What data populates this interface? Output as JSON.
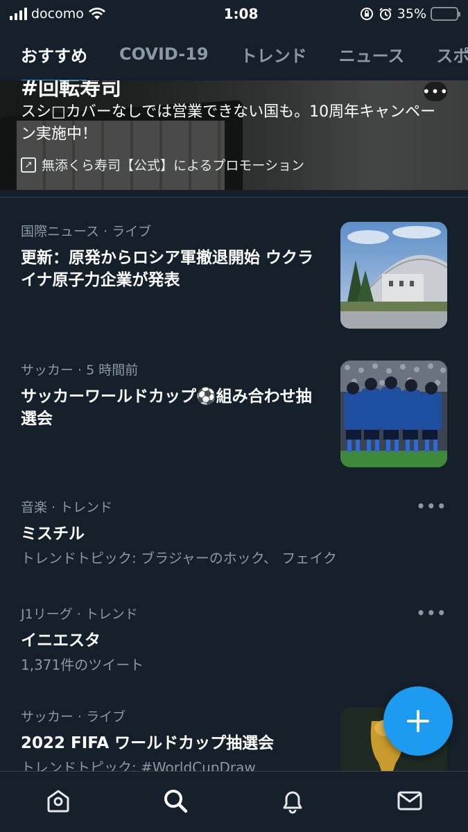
{
  "status_bar": {
    "carrier": "docomo",
    "time": "1:08",
    "battery": "35%",
    "battery_level": 0.35
  },
  "tabs": [
    {
      "label": "おすすめ",
      "active": true
    },
    {
      "label": "COVID-19",
      "active": false
    },
    {
      "label": "トレンド",
      "active": false
    },
    {
      "label": "ニュース",
      "active": false
    },
    {
      "label": "スポ",
      "active": false
    }
  ],
  "promo": {
    "title": "#回転寿司",
    "text": "スシ□カバーなしでは営業できない国も。10周年キャンペーン実施中！",
    "promoted_by": "無添くら寿司【公式】によるプロモーション"
  },
  "trends": [
    {
      "category": "国際ニュース",
      "status": "ライブ",
      "headline": "更新：原発からロシア軍撤退開始 ウクライナ原子力企業が発表",
      "thumbnail": "chernobyl-photo"
    },
    {
      "category": "サッカー",
      "status": "5 時間前",
      "headline": "サッカーワールドカップ⚽組み合わせ抽選会",
      "thumbnail": "soccer-team-photo"
    },
    {
      "category": "音楽",
      "status": "トレンド",
      "headline": "ミスチル",
      "sub": "トレンドトピック: ブラジャーのホック、 フェイク"
    },
    {
      "category": "J1リーグ",
      "status": "トレンド",
      "headline": "イニエスタ",
      "sub": "1,371件のツイート"
    },
    {
      "category": "サッカー",
      "status": "ライブ",
      "headline": "2022 FIFA ワールドカップ抽選会",
      "sub": "トレンドトピック: #WorldCupDraw",
      "thumbnail": "trophy-photo"
    }
  ],
  "more_label": "•••",
  "fab": {
    "icon": "compose-plus-icon"
  },
  "bottom_nav": [
    {
      "name": "home",
      "icon": "home-icon"
    },
    {
      "name": "explore",
      "icon": "search-icon"
    },
    {
      "name": "notifications",
      "icon": "bell-icon"
    },
    {
      "name": "messages",
      "icon": "mail-icon"
    }
  ],
  "colors": {
    "background": "#15202b",
    "accent": "#1d9bf0",
    "secondary_text": "#8b98a5",
    "divider": "#38444d"
  }
}
